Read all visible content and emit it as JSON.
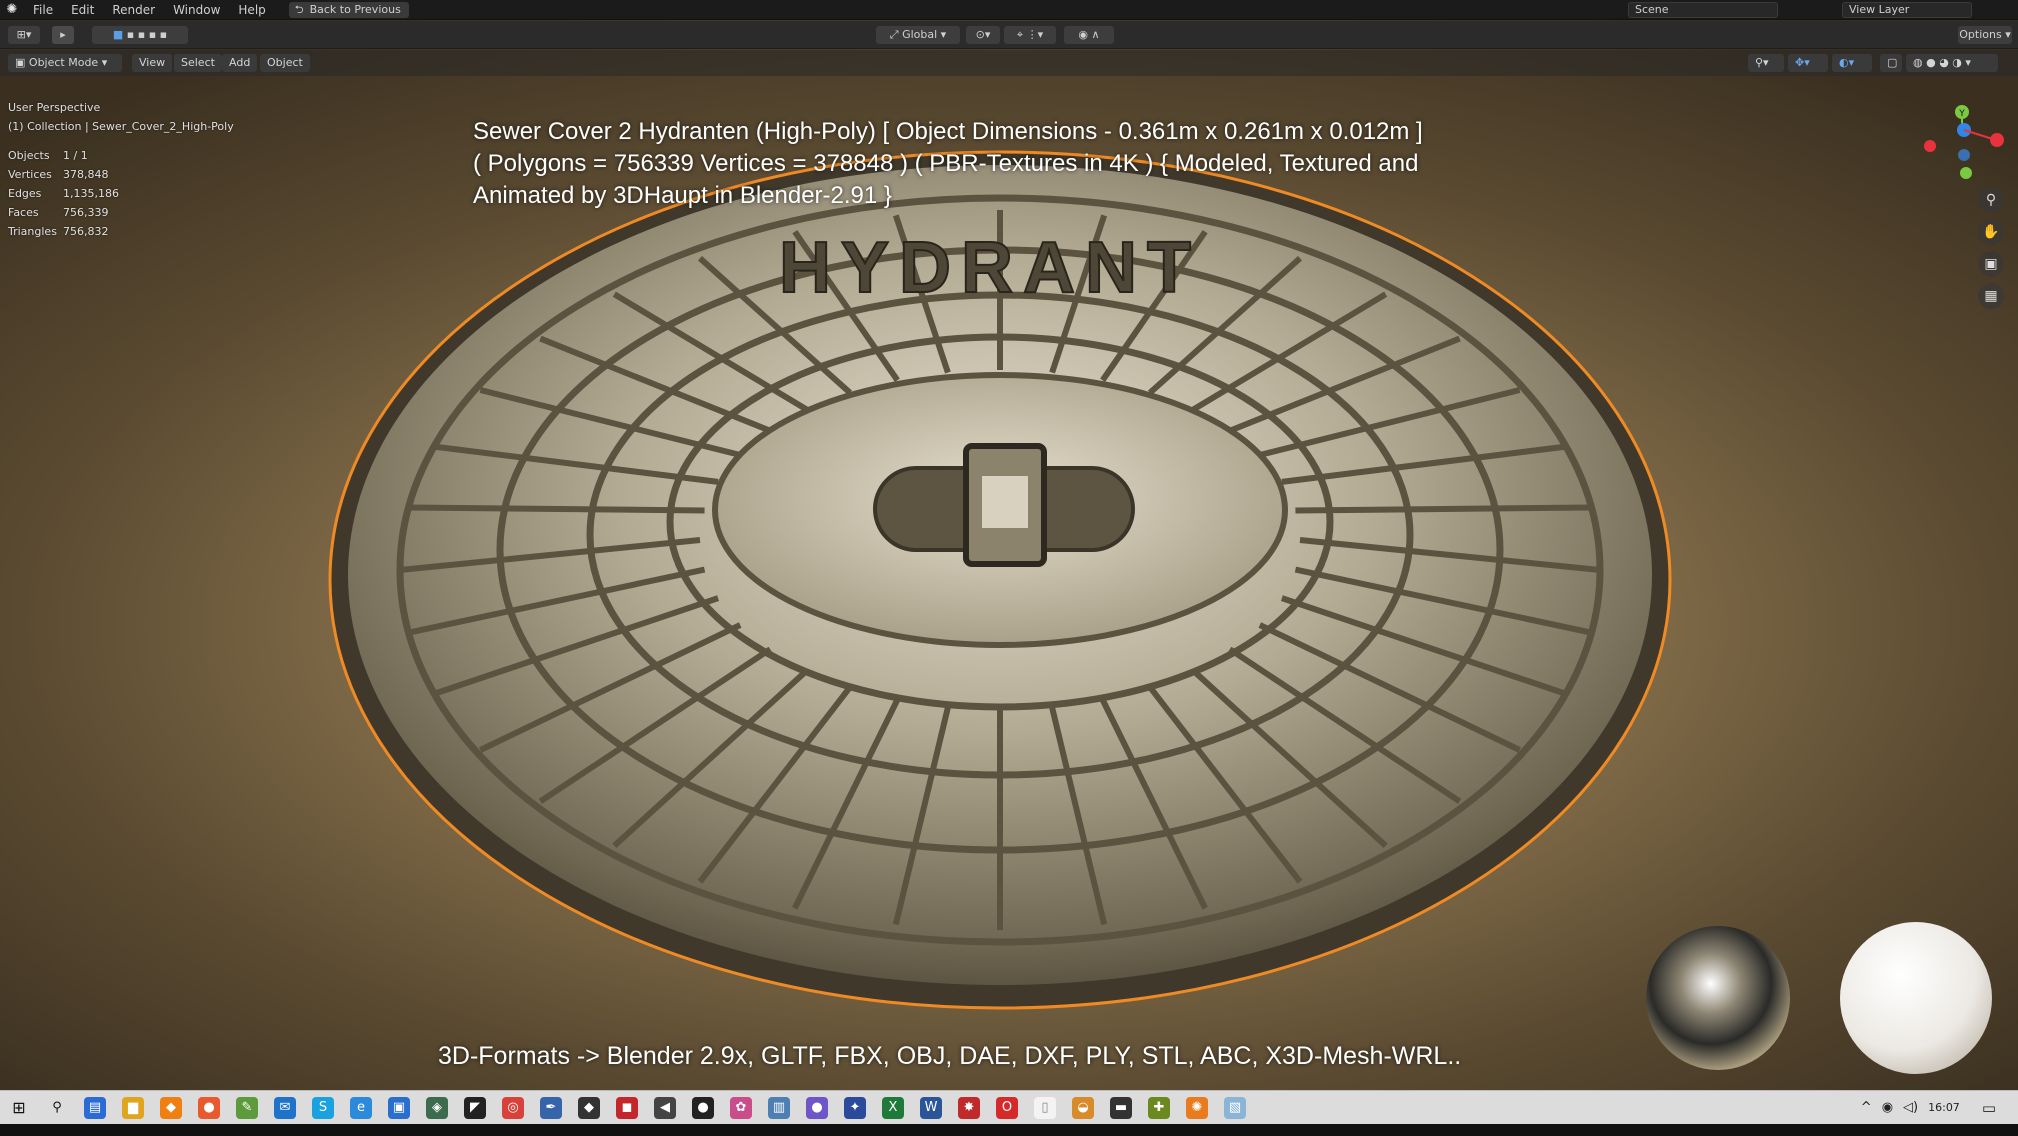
{
  "app": {
    "name": "Blender",
    "logo_icon": "blender-logo-icon"
  },
  "menu": [
    "File",
    "Edit",
    "Render",
    "Window",
    "Help"
  ],
  "back_button": "Back to Previous",
  "scene": {
    "label": "Scene",
    "view_layer": "View Layer"
  },
  "toolbar": {
    "orientation": "Global",
    "options": "Options"
  },
  "header": {
    "mode": "Object Mode",
    "view": "View",
    "select": "Select",
    "add": "Add",
    "object": "Object"
  },
  "viewport_info": {
    "perspective": "User Perspective",
    "collection": "(1) Collection | Sewer_Cover_2_High-Poly",
    "stats": [
      {
        "key": "Objects",
        "value": "1 / 1"
      },
      {
        "key": "Vertices",
        "value": "378,848"
      },
      {
        "key": "Edges",
        "value": "1,135,186"
      },
      {
        "key": "Faces",
        "value": "756,339"
      },
      {
        "key": "Triangles",
        "value": "756,832"
      }
    ]
  },
  "title_overlay": {
    "line1": "Sewer Cover 2 Hydranten (High-Poly) [ Object Dimensions -  0.361m x 0.261m x 0.012m ]",
    "line2": "( Polygons = 756339 Vertices = 378848 ) ( PBR-Textures in 4K ) { Modeled, Textured and",
    "line3": "Animated by 3DHaupt in Blender-2.91 }"
  },
  "cover_text": "HYDRANT",
  "formats_overlay": "3D-Formats -> Blender 2.9x, GLTF, FBX, OBJ, DAE, DXF, PLY, STL, ABC, X3D-Mesh-WRL..",
  "gizmo": {
    "y": "Y",
    "tools": [
      "zoom-icon",
      "hand-pan-icon",
      "camera-icon",
      "grid-icon"
    ]
  },
  "colors": {
    "accent_orange": "#f08a24",
    "axis_x": "#e8323d",
    "axis_y": "#7ac943",
    "axis_z": "#2f87e8"
  },
  "taskbar": {
    "time": "16:07"
  }
}
